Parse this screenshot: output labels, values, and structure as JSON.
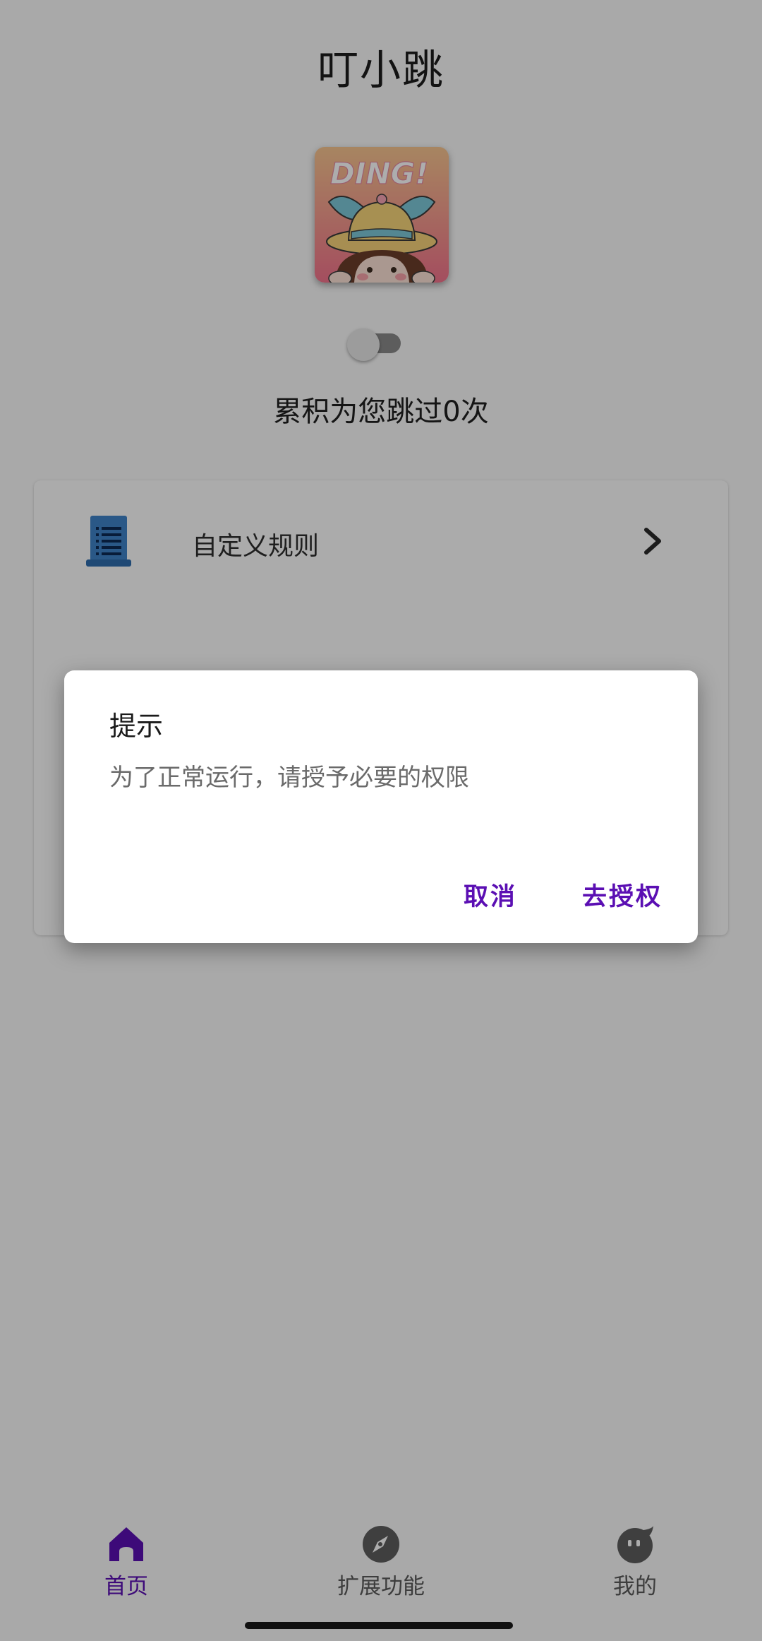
{
  "app": {
    "title": "叮小跳",
    "logo_text": "DING!",
    "skip_count_text": "累积为您跳过0次",
    "service_switch": {
      "on": false
    }
  },
  "rules": {
    "items": [
      {
        "label": "自定义规则",
        "icon": "document-list-icon"
      }
    ]
  },
  "dialog": {
    "title": "提示",
    "message": "为了正常运行，请授予必要的权限",
    "cancel_label": "取消",
    "confirm_label": "去授权"
  },
  "bottom_nav": {
    "items": [
      {
        "label": "首页",
        "icon": "home-icon",
        "active": true
      },
      {
        "label": "扩展功能",
        "icon": "compass-icon",
        "active": false
      },
      {
        "label": "我的",
        "icon": "face-icon",
        "active": false
      }
    ]
  },
  "colors": {
    "accent": "#5b0fb3",
    "scrim": "rgba(0,0,0,0.32)",
    "rule_icon": "#3e82c8"
  }
}
